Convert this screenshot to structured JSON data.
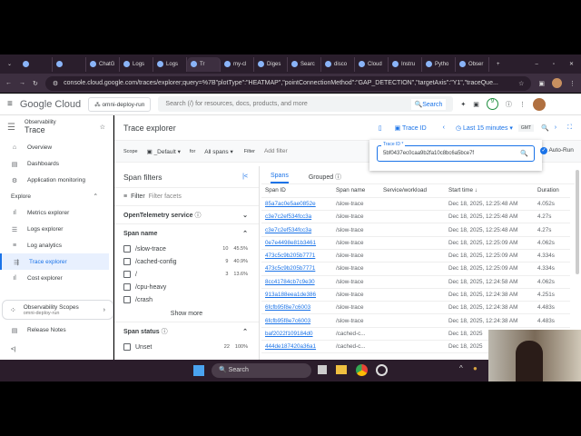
{
  "browser": {
    "tabs": [
      "",
      "",
      "ChatG",
      "Logs",
      "Logs",
      "Tr",
      "my-cl",
      "Diges",
      "Searc",
      "disco",
      "Cloud",
      "Instru",
      "Pytho",
      "Obser"
    ],
    "active_tab": 5,
    "url": "console.cloud.google.com/traces/explorer;query=%7B\"plotType\":\"HEATMAP\",\"pointConnectionMethod\":\"GAP_DETECTION\",\"targetAxis\":\"Y1\",\"traceQue..."
  },
  "gcp": {
    "logo": "Google Cloud",
    "project": "omni-deploy-run",
    "search_placeholder": "Search (/) for resources, docs, products, and more",
    "search_button": "Search"
  },
  "sidebar": {
    "section": "Observability",
    "title": "Trace",
    "items": [
      {
        "label": "Overview",
        "icon": "home-icon"
      },
      {
        "label": "Dashboards",
        "icon": "dashboard-icon"
      },
      {
        "label": "Application monitoring",
        "icon": "app-monitoring-icon"
      }
    ],
    "explore_label": "Explore",
    "explore_items": [
      {
        "label": "Metrics explorer"
      },
      {
        "label": "Logs explorer"
      },
      {
        "label": "Log analytics"
      },
      {
        "label": "Trace explorer",
        "active": true
      },
      {
        "label": "Cost explorer"
      }
    ],
    "scopes_title": "Observability Scopes",
    "scopes_sub": "omni-deploy-run",
    "release_notes": "Release Notes",
    "collapse": "<|"
  },
  "main": {
    "title": "Trace explorer",
    "trace_id_btn": "Trace ID",
    "time_range": "Last 15 minutes",
    "tz": "GMT",
    "scope_label": "Scope",
    "scope_value": "_Default",
    "for_label": "for",
    "spans_select": "All spans",
    "filter_label": "Filter",
    "filter_placeholder": "Add filter",
    "trace_id_label": "Trace ID *",
    "trace_id_value": "5bf0437ec0caa9b2fa10c8bc6a5bce7f",
    "auto_run": "Auto-Run"
  },
  "span_filters": {
    "title": "Span filters",
    "filter": "Filter",
    "filter_placeholder": "Filter facets",
    "otel": "OpenTelemetry service",
    "span_name": "Span name",
    "names": [
      {
        "name": "/slow-trace",
        "count": "10",
        "pct": "45.5%"
      },
      {
        "name": "/cached-config",
        "count": "9",
        "pct": "40.9%"
      },
      {
        "name": "/",
        "count": "3",
        "pct": "13.6%"
      },
      {
        "name": "/cpu-heavy",
        "count": "",
        "pct": ""
      },
      {
        "name": "/crash",
        "count": "",
        "pct": ""
      }
    ],
    "show_more": "Show more",
    "span_status": "Span status",
    "statuses": [
      {
        "name": "Unset",
        "count": "22",
        "pct": "100%"
      }
    ]
  },
  "results": {
    "tabs": [
      "Spans",
      "Grouped"
    ],
    "columns": [
      "Span ID",
      "Span name",
      "Service/workload",
      "Start time",
      "Duration"
    ],
    "rows": [
      [
        "85a7ac0e5ae0852e",
        "/slow-trace",
        "",
        "Dec 18, 2025, 12:25:48 AM",
        "4.052s"
      ],
      [
        "c3e7c2ef534fcc3a",
        "/slow-trace",
        "",
        "Dec 18, 2025, 12:25:48 AM",
        "4.27s"
      ],
      [
        "c3e7c2ef534fcc3a",
        "/slow-trace",
        "",
        "Dec 18, 2025, 12:25:48 AM",
        "4.27s"
      ],
      [
        "0e7e4498e81b3461",
        "/slow-trace",
        "",
        "Dec 18, 2025, 12:25:09 AM",
        "4.062s"
      ],
      [
        "473c5c9b205b7771",
        "/slow-trace",
        "",
        "Dec 18, 2025, 12:25:09 AM",
        "4.334s"
      ],
      [
        "473c5c9b205b7771",
        "/slow-trace",
        "",
        "Dec 18, 2025, 12:25:09 AM",
        "4.334s"
      ],
      [
        "8cc41784cb7c9e30",
        "/slow-trace",
        "",
        "Dec 18, 2025, 12:24:58 AM",
        "4.062s"
      ],
      [
        "913a188eea1de386",
        "/slow-trace",
        "",
        "Dec 18, 2025, 12:24:38 AM",
        "4.251s"
      ],
      [
        "6fcfb95f8e7c6003",
        "/slow-trace",
        "",
        "Dec 18, 2025, 12:24:38 AM",
        "4.483s"
      ],
      [
        "6fcfb95f8e7c6003",
        "/slow-trace",
        "",
        "Dec 18, 2025, 12:24:38 AM",
        "4.483s"
      ],
      [
        "baf2022f109184d0",
        "/cached-c...",
        "",
        "Dec 18, 2025",
        ""
      ],
      [
        "444de187420a36a1",
        "/cached-c...",
        "",
        "Dec 18, 2025",
        ""
      ]
    ]
  },
  "taskbar": {
    "search": "Search"
  }
}
